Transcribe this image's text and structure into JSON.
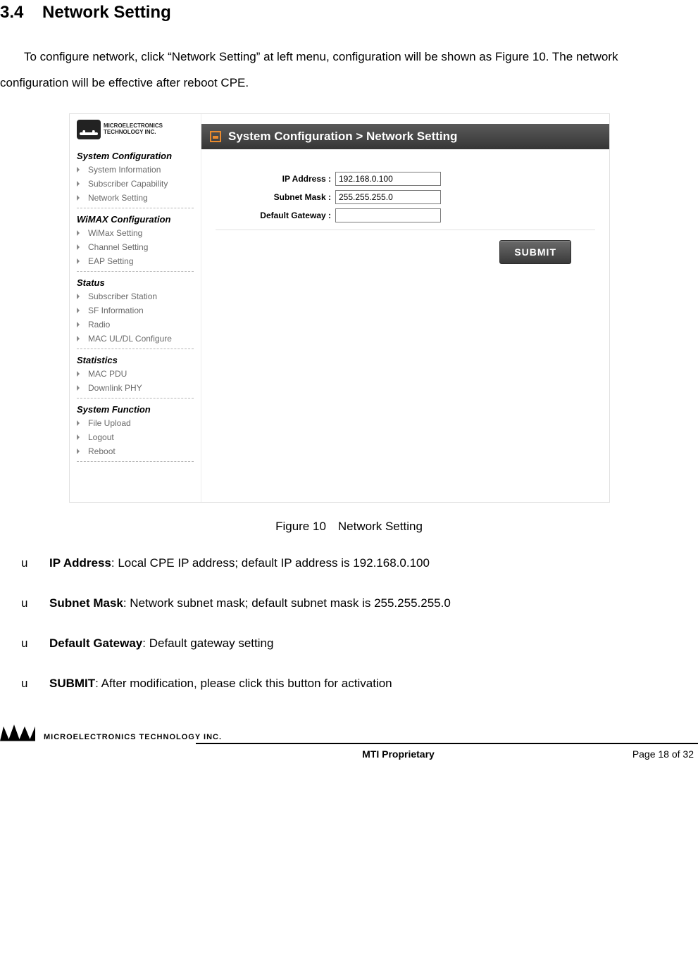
{
  "section_number": "3.4",
  "section_title": "Network Setting",
  "intro_paragraph": "To configure network, click “Network Setting” at left menu, configuration will be shown as Figure 10. The network configuration will be effective after reboot CPE.",
  "screenshot": {
    "logo_lines": [
      "MICROELECTRONICS",
      "TECHNOLOGY INC."
    ],
    "breadcrumb": "System Configuration > Network Setting",
    "sidebar": [
      {
        "header": "System Configuration",
        "items": [
          "System Information",
          "Subscriber Capability",
          "Network Setting"
        ]
      },
      {
        "header": "WiMAX Configuration",
        "items": [
          "WiMax Setting",
          "Channel Setting",
          "EAP Setting"
        ]
      },
      {
        "header": "Status",
        "items": [
          "Subscriber Station",
          "SF Information",
          "Radio",
          "MAC UL/DL Configure"
        ]
      },
      {
        "header": "Statistics",
        "items": [
          "MAC PDU",
          "Downlink PHY"
        ]
      },
      {
        "header": "System Function",
        "items": [
          "File Upload",
          "Logout",
          "Reboot"
        ]
      }
    ],
    "fields": {
      "ip_label": "IP Address :",
      "ip_value": "192.168.0.100",
      "mask_label": "Subnet Mask :",
      "mask_value": "255.255.255.0",
      "gw_label": "Default Gateway :",
      "gw_value": ""
    },
    "submit_label": "SUBMIT"
  },
  "caption": "Figure 10 Network Setting",
  "bullets": [
    {
      "marker": "u",
      "term": "IP Address",
      "desc": ": Local CPE IP address; default IP address is 192.168.0.100"
    },
    {
      "marker": "u",
      "term": "Subnet Mask",
      "desc": ": Network subnet mask; default subnet mask is 255.255.255.0"
    },
    {
      "marker": "u",
      "term": "Default Gateway",
      "desc": ": Default gateway setting"
    },
    {
      "marker": "u",
      "term": "SUBMIT",
      "desc": ": After modification, please click this button for activation"
    }
  ],
  "footer": {
    "company": "MICROELECTRONICS TECHNOLOGY INC.",
    "center": "MTI Proprietary",
    "page": "Page 18 of 32"
  }
}
